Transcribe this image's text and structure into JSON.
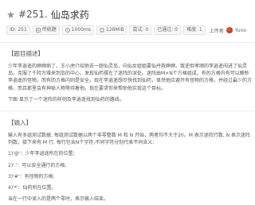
{
  "problem": {
    "id_label": "#251.",
    "name": "仙岛求药"
  },
  "meta": {
    "id": "ID: 251",
    "type": "传统题",
    "time": "1000ms",
    "memory": "128MiB",
    "tried": "尝试: 0",
    "accepted": "已通过: 0",
    "difficulty": "难度: 1",
    "uploader_label": "上传者",
    "uploader_name": "Yuno"
  },
  "description": {
    "heading": "【题目描述】",
    "paragraphs": [
      "少年李逍遥的婶婶病了，王小虎介绍他去一趟仙灵岛，向仙女姐姐要仙丹救婶婶。叛逆但孝顺的李逍遥闯进了仙灵岛，克服了千险万难来到岛的中心，发现仙药摆在了迷阵的深处。迷阵由M×N个方格组成，有的方格内有可以瞬秒李逍遥的怪物，而有的方格内则是安全。现在李逍遥想尽快找到仙药，显然他应避开有怪物的方格，并经过最少的方格，而且那里会有神秘人物等待着他。现在要求你来帮助他实现这个目标。",
      "下图 显示了一个迷阵的样例及李逍遥找到仙药的路线。"
    ]
  },
  "input": {
    "heading": "【输入】",
    "paragraphs": [
      "输入有多组测试数据. 每组测试数据以两个非零整数 M 和 N 开始，两者均不大于20。M 表示迷阵行数, N 表示迷阵列数。接下来有 M 行, 每行包含N个字符,不同字符分别代表不同含义:",
      "1)'@'：少年李逍遥所在的位置;",
      "2)'.'：可以安全通行的方格;",
      "3)'#'：有怪物的方格;",
      "4)'*'：仙药所在位置。",
      "当在一行中读入的是两个零时，表示输入结束。"
    ]
  },
  "colors": {
    "accent": "#3f7fc8",
    "avatar": "#c84a2a"
  }
}
